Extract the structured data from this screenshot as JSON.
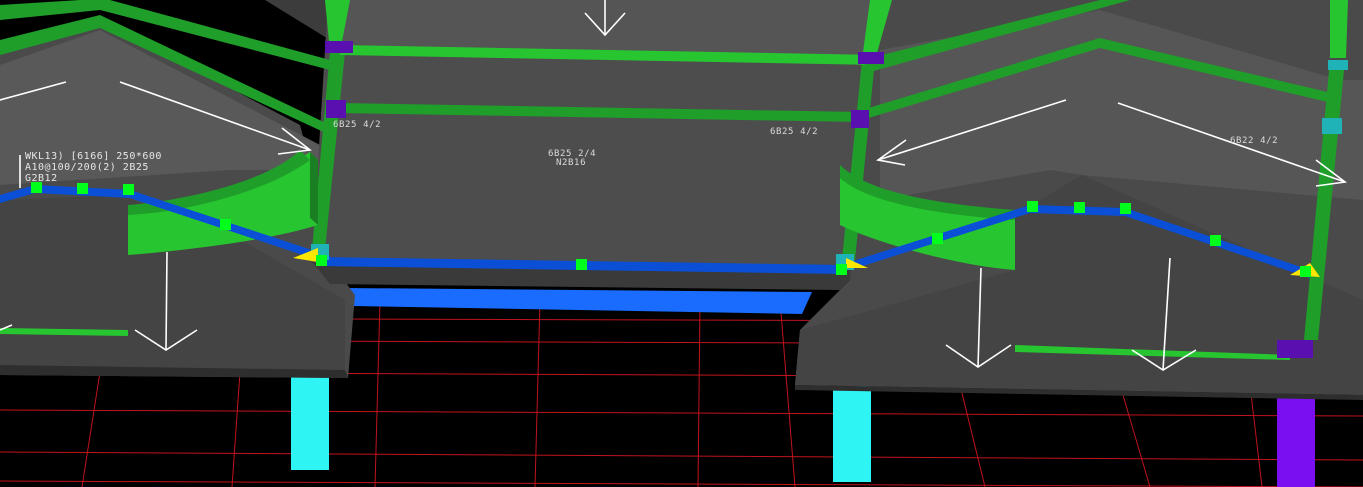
{
  "app": {
    "view_name": "3D structural model view"
  },
  "colors": {
    "background": "#000000",
    "grid_line": "#c0141c",
    "slab_top": "#595959",
    "slab_mid": "#4a4a4a",
    "slab_side": "#3a3a3a",
    "beam_green": "#1f9e2a",
    "beam_green_light": "#27c631",
    "beam_edge_blue": "#0a4fd6",
    "beam_face_blue": "#1a6cff",
    "column_cyan": "#2ef4f4",
    "column_purple": "#7a10f0",
    "node_green": "#00ff1a",
    "joint_purple": "#5a10b0",
    "joint_cyan": "#1fb3b8",
    "marker_yellow": "#ffe600",
    "arrow_white": "#ffffff"
  },
  "annotations": {
    "wkl_line1": "WKL13) [6166] 250*600",
    "wkl_line2": "A10@100/200(2) 2B25",
    "wkl_line3": "G2B12",
    "rebar_left": "6B25 4/2",
    "rebar_center_line1": "6B25 2/4",
    "rebar_center_line2": "N2B16",
    "rebar_center_right": "6B25 4/2",
    "rebar_right": "6B22 4/2"
  }
}
